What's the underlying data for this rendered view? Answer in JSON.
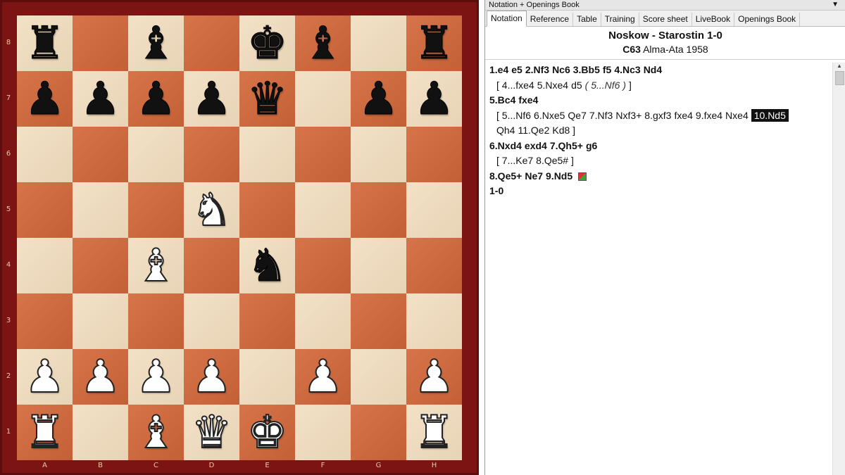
{
  "board": {
    "files": [
      "A",
      "B",
      "C",
      "D",
      "E",
      "F",
      "G",
      "H"
    ],
    "ranks": [
      "8",
      "7",
      "6",
      "5",
      "4",
      "3",
      "2",
      "1"
    ],
    "squares": [
      [
        "bR",
        "",
        "bB",
        "",
        "bK",
        "bB",
        "",
        "bR"
      ],
      [
        "bP",
        "bP",
        "bP",
        "bP",
        "bQ",
        "",
        "bP",
        "bP"
      ],
      [
        "",
        "",
        "",
        "",
        "",
        "",
        "",
        ""
      ],
      [
        "",
        "",
        "",
        "wN",
        "",
        "",
        "",
        ""
      ],
      [
        "",
        "",
        "wB",
        "",
        "bN",
        "",
        "",
        ""
      ],
      [
        "",
        "",
        "",
        "",
        "",
        "",
        "",
        ""
      ],
      [
        "wP",
        "wP",
        "wP",
        "wP",
        "",
        "wP",
        "",
        "wP"
      ],
      [
        "wR",
        "",
        "wB",
        "wQ",
        "wK",
        "",
        "",
        "wR"
      ]
    ],
    "light_color": "#f1dcbd",
    "dark_color": "#d4683a",
    "frame_color": "#7d1414"
  },
  "panel": {
    "title": "Notation + Openings Book",
    "dropdown_icon": "triangle-down-icon",
    "tabs": [
      "Notation",
      "Reference",
      "Table",
      "Training",
      "Score sheet",
      "LiveBook",
      "Openings Book"
    ],
    "active_tab": "Notation"
  },
  "game": {
    "title": "Noskow - Starostin  1-0",
    "eco": "C63",
    "event": "Alma-Ata 1958"
  },
  "notation": [
    {
      "kind": "main",
      "tokens": [
        "1.e4",
        "e5",
        "2.Nf3",
        "Nc6",
        "3.Bb5",
        "f5",
        "4.Nc3",
        "Nd4"
      ]
    },
    {
      "kind": "var",
      "tokens": [
        "[ 4...fxe4",
        "5.Nxe4",
        "d5",
        "( 5...Nf6 )",
        "]"
      ]
    },
    {
      "kind": "main",
      "tokens": [
        "5.Bc4",
        "fxe4"
      ]
    },
    {
      "kind": "var",
      "tokens": [
        "[ 5...Nf6",
        "6.Nxe5",
        "Qe7",
        "7.Nf3",
        "Nxf3+",
        "8.gxf3",
        "fxe4",
        "9.fxe4",
        "Nxe4",
        "10.Nd5"
      ]
    },
    {
      "kind": "var",
      "tokens": [
        "Qh4",
        "11.Qe2",
        "Kd8 ]"
      ]
    },
    {
      "kind": "main",
      "tokens": [
        "6.Nxd4",
        "exd4",
        "7.Qh5+",
        "g6"
      ]
    },
    {
      "kind": "var",
      "tokens": [
        "[ 7...Ke7",
        "8.Qe5# ]"
      ]
    },
    {
      "kind": "main",
      "tokens": [
        "8.Qe5+",
        "Ne7",
        "9.Nd5"
      ]
    },
    {
      "kind": "main",
      "tokens": [
        "1-0"
      ]
    }
  ],
  "highlighted_move": "10.Nd5"
}
